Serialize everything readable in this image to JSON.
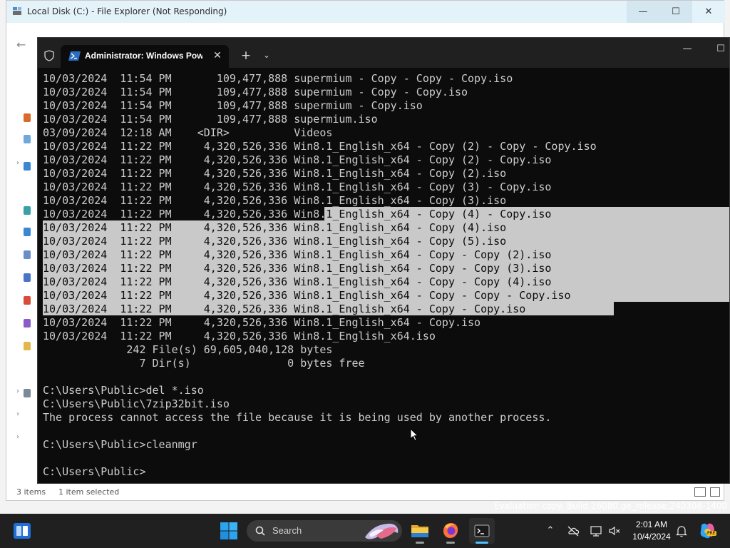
{
  "explorer": {
    "title": "Local Disk (C:) - File Explorer (Not Responding)",
    "status_items": "3 items",
    "status_selected": "1 item selected",
    "build_watermark": "Evaluation copy. Build 26080.ge_release.240308-1400"
  },
  "terminal": {
    "tab_title": "Administrator: Windows PowerShell",
    "lines": [
      {
        "text": "10/03/2024  11:54 PM       109,477,888 supermium - Copy - Copy - Copy.iso",
        "selected": false
      },
      {
        "text": "10/03/2024  11:54 PM       109,477,888 supermium - Copy - Copy.iso",
        "selected": false
      },
      {
        "text": "10/03/2024  11:54 PM       109,477,888 supermium - Copy.iso",
        "selected": false
      },
      {
        "text": "10/03/2024  11:54 PM       109,477,888 supermium.iso",
        "selected": false
      },
      {
        "text": "03/09/2024  12:18 AM    <DIR>          Videos",
        "selected": false
      },
      {
        "text": "10/03/2024  11:22 PM     4,320,526,336 Win8.1_English_x64 - Copy (2) - Copy - Copy.iso",
        "selected": false
      },
      {
        "text": "10/03/2024  11:22 PM     4,320,526,336 Win8.1_English_x64 - Copy (2) - Copy.iso",
        "selected": false
      },
      {
        "text": "10/03/2024  11:22 PM     4,320,526,336 Win8.1_English_x64 - Copy (2).iso",
        "selected": false
      },
      {
        "text": "10/03/2024  11:22 PM     4,320,526,336 Win8.1_English_x64 - Copy (3) - Copy.iso",
        "selected": false
      },
      {
        "text": "10/03/2024  11:22 PM     4,320,526,336 Win8.1_English_x64 - Copy (3).iso",
        "selected": false
      },
      {
        "text": "10/03/2024  11:22 PM     4,320,526,336 Win8.1_English_x64 - Copy (4) - Copy.iso",
        "selected": "partial"
      },
      {
        "text": "10/03/2024  11:22 PM     4,320,526,336 Win8.1_English_x64 - Copy (4).iso",
        "selected": true
      },
      {
        "text": "10/03/2024  11:22 PM     4,320,526,336 Win8.1_English_x64 - Copy (5).iso",
        "selected": true
      },
      {
        "text": "10/03/2024  11:22 PM     4,320,526,336 Win8.1_English_x64 - Copy - Copy (2).iso",
        "selected": true
      },
      {
        "text": "10/03/2024  11:22 PM     4,320,526,336 Win8.1_English_x64 - Copy - Copy (3).iso",
        "selected": true
      },
      {
        "text": "10/03/2024  11:22 PM     4,320,526,336 Win8.1_English_x64 - Copy - Copy (4).iso",
        "selected": true
      },
      {
        "text": "10/03/2024  11:22 PM     4,320,526,336 Win8.1_English_x64 - Copy - Copy - Copy.iso",
        "selected": true
      },
      {
        "text": "10/03/2024  11:22 PM     4,320,526,336 Win8.1_English_x64 - Copy - Copy.iso",
        "selected": true
      },
      {
        "text": "10/03/2024  11:22 PM     4,320,526,336 Win8.1_English_x64 - Copy.iso",
        "selected": false
      },
      {
        "text": "10/03/2024  11:22 PM     4,320,526,336 Win8.1_English_x64.iso",
        "selected": false
      },
      {
        "text": "             242 File(s) 69,605,040,128 bytes",
        "selected": false
      },
      {
        "text": "               7 Dir(s)               0 bytes free",
        "selected": false
      },
      {
        "text": "",
        "selected": false
      },
      {
        "text": "C:\\Users\\Public>del *.iso",
        "selected": false
      },
      {
        "text": "C:\\Users\\Public\\7zip32bit.iso",
        "selected": false
      },
      {
        "text": "The process cannot access the file because it is being used by another process.",
        "selected": false
      },
      {
        "text": "",
        "selected": false
      },
      {
        "text": "C:\\Users\\Public>cleanmgr",
        "selected": false
      },
      {
        "text": "",
        "selected": false
      },
      {
        "text": "C:\\Users\\Public>",
        "selected": false
      }
    ]
  },
  "taskbar": {
    "search_placeholder": "Search",
    "clock_time": "2:01 AM",
    "clock_date": "10/4/2024",
    "copilot_badge": "PRE"
  },
  "colors": {
    "terminal_bg": "#0c0c0c",
    "terminal_text": "#cccccc",
    "selection": "#c9c9c9",
    "taskbar_bg": "#202020",
    "accent": "#4cc2ff"
  },
  "icons": [
    "windows-logo-icon",
    "shield-icon",
    "powershell-icon",
    "close-icon",
    "plus-icon",
    "chevron-down-icon",
    "minimize-icon",
    "maximize-icon",
    "search-icon",
    "folder-icon",
    "firefox-icon",
    "terminal-icon",
    "chevron-up-icon",
    "cloud-off-icon",
    "network-icon",
    "mute-icon",
    "bell-icon",
    "copilot-icon",
    "mouse-pointer-icon"
  ]
}
